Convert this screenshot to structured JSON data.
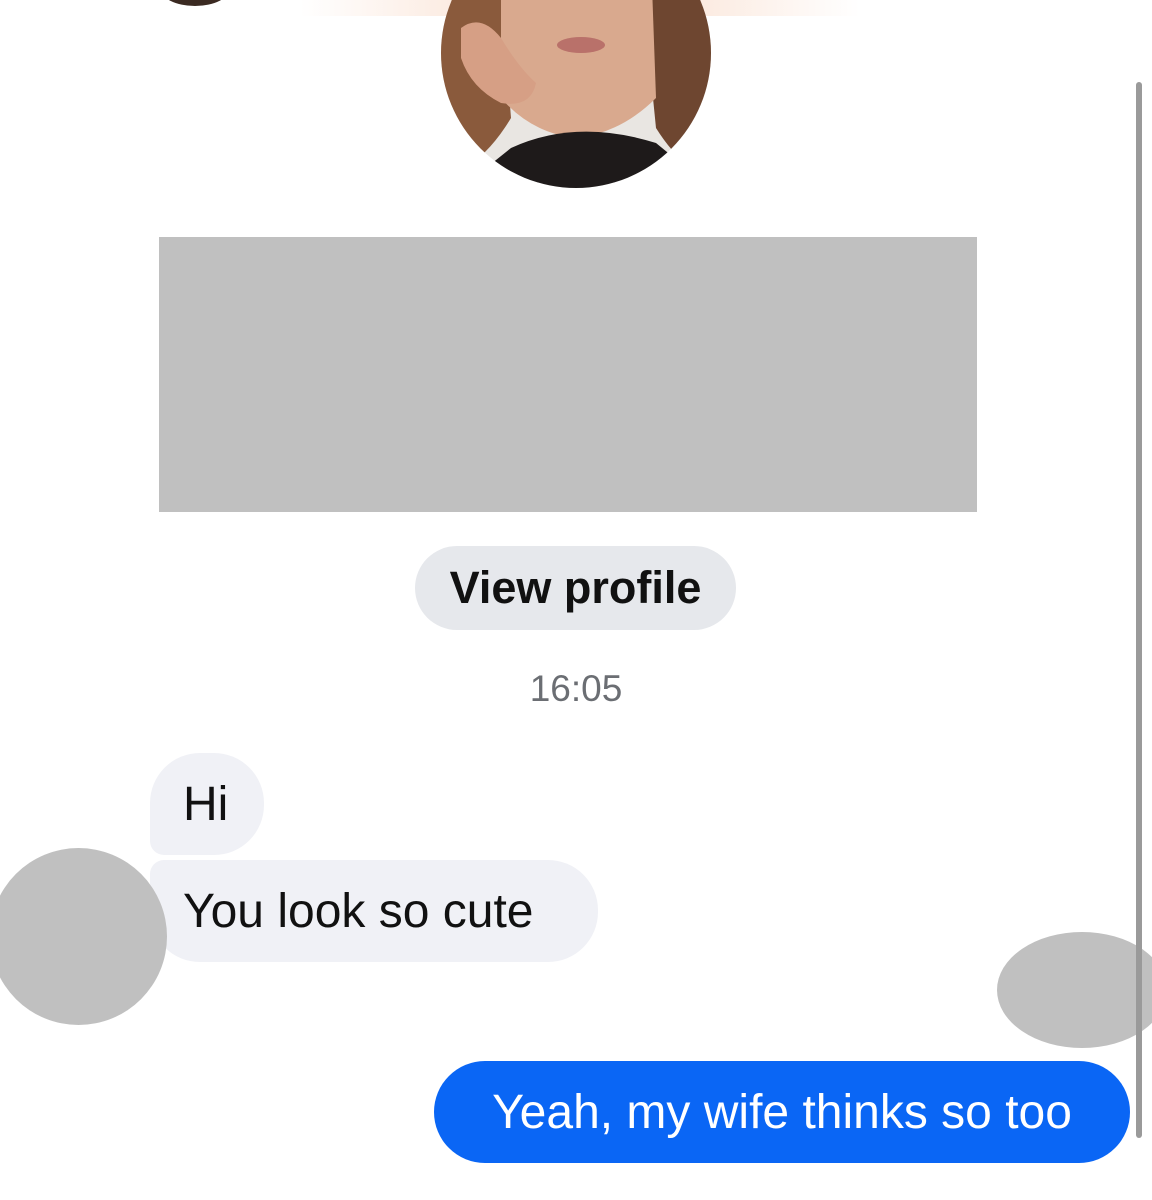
{
  "profile": {
    "view_profile_label": "View profile"
  },
  "conversation": {
    "timestamp": "16:05",
    "messages": [
      {
        "direction": "incoming",
        "text": "Hi"
      },
      {
        "direction": "incoming",
        "text": "You look so cute"
      },
      {
        "direction": "outgoing",
        "text": "Yeah, my wife thinks so too"
      }
    ]
  },
  "colors": {
    "outgoing_bubble": "#0a66f5",
    "incoming_bubble": "#f0f1f6",
    "button_bg": "#e6e8ec",
    "redaction_gray": "#c0c0c0",
    "timestamp_text": "#6b6e73"
  }
}
